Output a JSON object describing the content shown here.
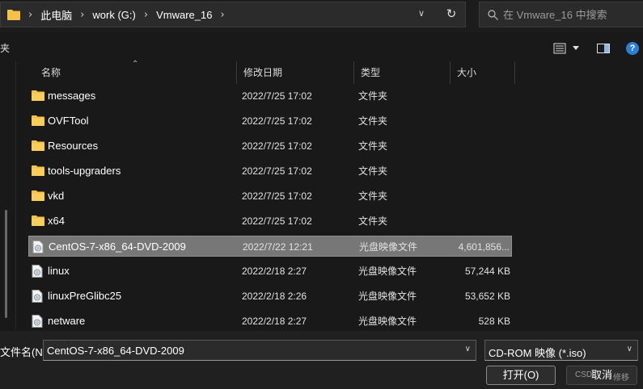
{
  "breadcrumb": {
    "items": [
      "此电脑",
      "work (G:)",
      "Vmware_16"
    ],
    "separator": "›"
  },
  "search": {
    "placeholder": "在 Vmware_16 中搜索"
  },
  "toolbar": {
    "left_label": "夹",
    "help_label": "?"
  },
  "columns": {
    "name": "名称",
    "date": "修改日期",
    "type": "类型",
    "size": "大小"
  },
  "files": [
    {
      "name": "messages",
      "date": "2022/7/25 17:02",
      "type": "文件夹",
      "size": "",
      "icon": "folder-icon"
    },
    {
      "name": "OVFTool",
      "date": "2022/7/25 17:02",
      "type": "文件夹",
      "size": "",
      "icon": "folder-icon"
    },
    {
      "name": "Resources",
      "date": "2022/7/25 17:02",
      "type": "文件夹",
      "size": "",
      "icon": "folder-icon"
    },
    {
      "name": "tools-upgraders",
      "date": "2022/7/25 17:02",
      "type": "文件夹",
      "size": "",
      "icon": "folder-icon"
    },
    {
      "name": "vkd",
      "date": "2022/7/25 17:02",
      "type": "文件夹",
      "size": "",
      "icon": "folder-icon"
    },
    {
      "name": "x64",
      "date": "2022/7/25 17:02",
      "type": "文件夹",
      "size": "",
      "icon": "folder-icon"
    },
    {
      "name": "CentOS-7-x86_64-DVD-2009",
      "date": "2022/7/22 12:21",
      "type": "光盘映像文件",
      "size": "4,601,856...",
      "icon": "disc-image-icon",
      "selected": true
    },
    {
      "name": "linux",
      "date": "2022/2/18 2:27",
      "type": "光盘映像文件",
      "size": "57,244 KB",
      "icon": "disc-image-icon"
    },
    {
      "name": "linuxPreGlibc25",
      "date": "2022/2/18 2:26",
      "type": "光盘映像文件",
      "size": "53,652 KB",
      "icon": "disc-image-icon"
    },
    {
      "name": "netware",
      "date": "2022/2/18 2:27",
      "type": "光盘映像文件",
      "size": "528 KB",
      "icon": "disc-image-icon"
    }
  ],
  "bottom": {
    "filename_label": "文件名(N):",
    "filename_value": "CentOS-7-x86_64-DVD-2009",
    "filetype_value": "CD-ROM 映像 (*.iso)",
    "open_label": "打开(O)",
    "cancel_label": "取消",
    "watermark_left": "CSD",
    "watermark_right": "修移"
  },
  "colors": {
    "selection": "#777777",
    "folder": "#f4c14a",
    "accent": "#2d7fd6"
  }
}
